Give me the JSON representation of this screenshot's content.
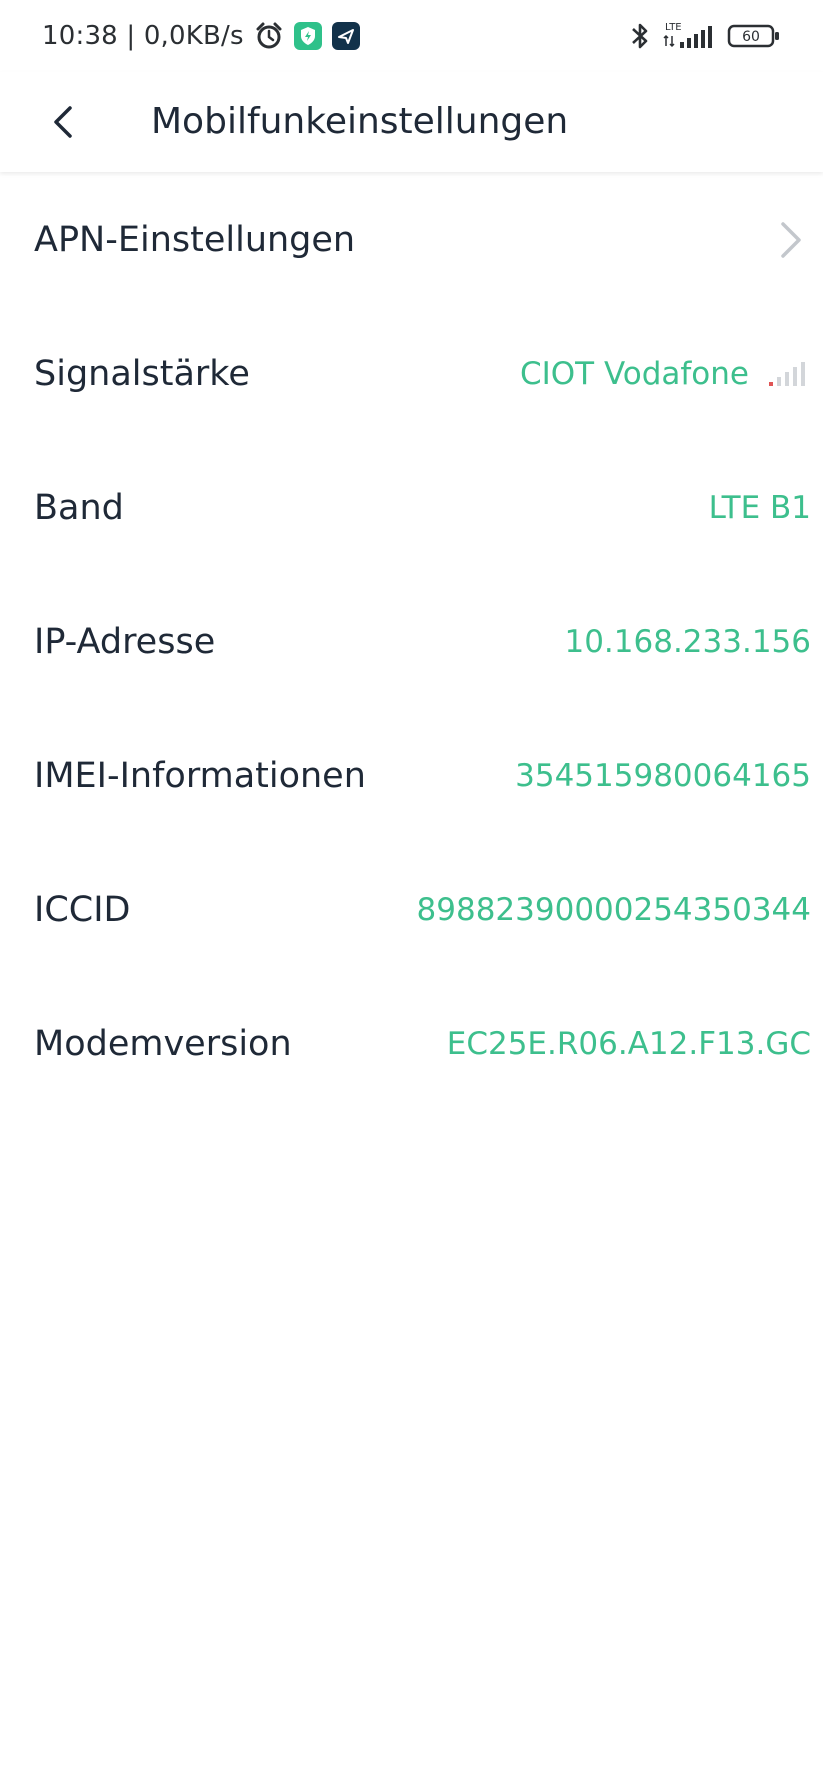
{
  "status_bar": {
    "time_speed": "10:38 | 0,0KB/s",
    "network_type": "LTE",
    "battery_level": "60"
  },
  "header": {
    "title": "Mobilfunkeinstellungen"
  },
  "rows": [
    {
      "label": "APN-Einstellungen",
      "value": ""
    },
    {
      "label": "Signalstärke",
      "value": "CIOT Vodafone"
    },
    {
      "label": "Band",
      "value": "LTE B1"
    },
    {
      "label": "IP-Adresse",
      "value": "10.168.233.156"
    },
    {
      "label": "IMEI-Informationen",
      "value": "354515980064165"
    },
    {
      "label": "ICCID",
      "value": "89882390000254350344"
    },
    {
      "label": "Modemversion",
      "value": "EC25E.R06.A12.F13.GC"
    }
  ],
  "icons": {
    "alarm": "alarm-clock-icon",
    "vpn": "shield-app-icon",
    "app": "paper-plane-app-icon",
    "bluetooth": "bluetooth-icon",
    "signal": "cell-signal-icon",
    "battery": "battery-icon",
    "back": "back-arrow-icon",
    "chevron": "chevron-right-icon",
    "signal_strength": "signal-strength-icon"
  },
  "colors": {
    "accent": "#3dbf8d",
    "text": "#1f2937",
    "muted": "#c7cbd1",
    "signal_low": "#e05555"
  }
}
